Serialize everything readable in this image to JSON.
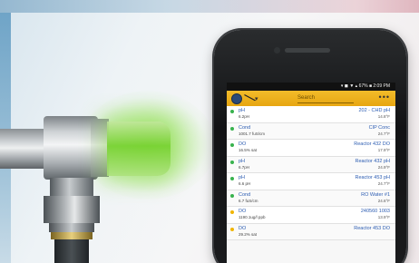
{
  "colors": {
    "accent": "#e9ab17",
    "status_green": "#37b24d",
    "status_yellow": "#f0b400",
    "link_blue": "#2d5db2"
  },
  "app": {
    "status_bar": "▾ ◼ ▼ ▴ 67% ■ 2:09 PM",
    "search_label": "Search",
    "menu_icon": "more-icon",
    "logo_icon": "app-logo-icon",
    "probe_icon": "probe-icon"
  },
  "probes": [
    {
      "type": "pH",
      "value": "6.2pH",
      "name": "202 - CHD pH",
      "temp": "14.8°F",
      "status": "green"
    },
    {
      "type": "Cond",
      "value": "1001.7 fuS/cm",
      "name": "CIP Conc",
      "temp": "24.7°F",
      "status": "green"
    },
    {
      "type": "DO",
      "value": "16.5% sat",
      "name": "Reactor 432 DO",
      "temp": "17.9°F",
      "status": "green"
    },
    {
      "type": "pH",
      "value": "6.7pH",
      "name": "Reactor 432 pH",
      "temp": "24.9°F",
      "status": "green"
    },
    {
      "type": "pH",
      "value": "6.6 pH",
      "name": "Reactor 453 pH",
      "temp": "24.7°F",
      "status": "green"
    },
    {
      "type": "Cond",
      "value": "6.7 fuS/cm",
      "name": "RO Water #1",
      "temp": "24.6°F",
      "status": "green"
    },
    {
      "type": "DO",
      "value": "1190.1ug/l ppb",
      "name": "240560 1003",
      "temp": "13.9°F",
      "status": "yellow"
    },
    {
      "type": "DO",
      "value": "29.2% sat",
      "name": "Reactor 453 DO",
      "temp": "",
      "status": "yellow"
    }
  ]
}
